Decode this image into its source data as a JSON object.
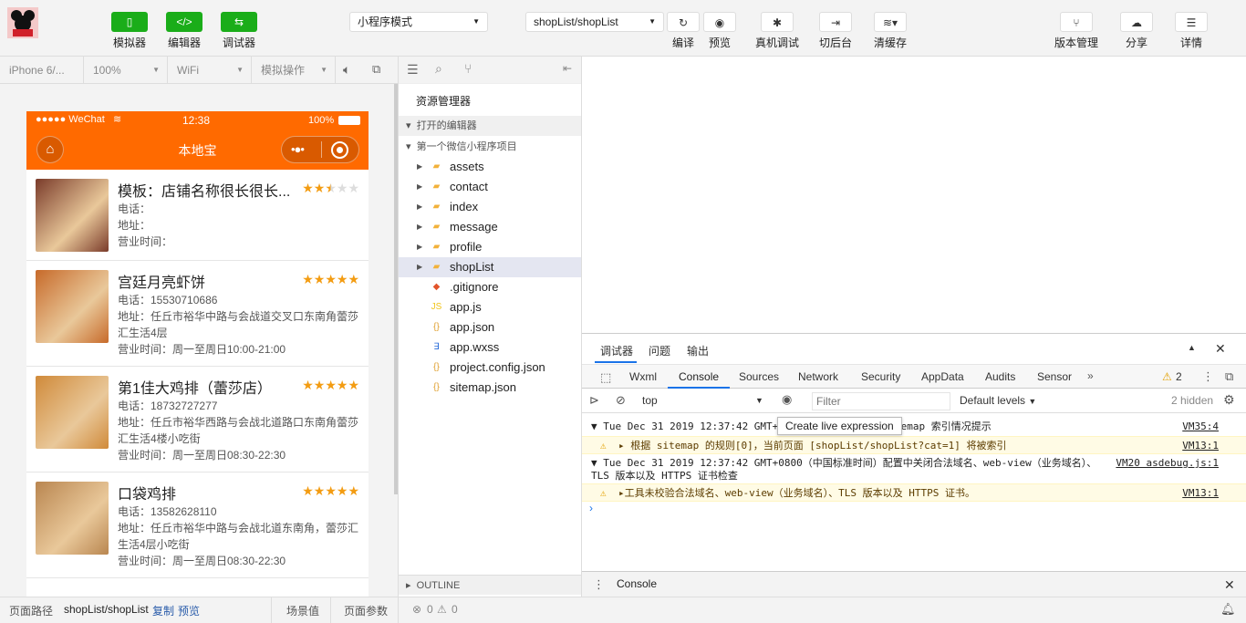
{
  "toolbar": {
    "left_buttons": [
      {
        "label": "模拟器",
        "icon": "phone-icon",
        "glyph": "▯"
      },
      {
        "label": "编辑器",
        "icon": "code-icon",
        "glyph": "</>"
      },
      {
        "label": "调试器",
        "icon": "debug-icon",
        "glyph": "⇆"
      }
    ],
    "mode_select": "小程序模式",
    "page_select": "shopList/shopList",
    "action_buttons": [
      {
        "label": "编译",
        "icon": "refresh-icon",
        "glyph": "↻"
      },
      {
        "label": "预览",
        "icon": "eye-icon",
        "glyph": "◉"
      },
      {
        "label": "真机调试",
        "icon": "bug-icon",
        "glyph": "✱"
      },
      {
        "label": "切后台",
        "icon": "switch-icon",
        "glyph": "⇥"
      },
      {
        "label": "清缓存",
        "icon": "layers-icon",
        "glyph": "≋▾"
      }
    ],
    "right_buttons": [
      {
        "label": "版本管理",
        "icon": "branch-icon",
        "glyph": "⑂"
      },
      {
        "label": "分享",
        "icon": "cloud-icon",
        "glyph": "☁"
      },
      {
        "label": "详情",
        "icon": "menu-icon",
        "glyph": "☰"
      }
    ]
  },
  "simbar": {
    "device": "iPhone 6/...",
    "zoom": "100%",
    "network": "WiFi",
    "operation": "模拟操作"
  },
  "phone": {
    "carrier": "●●●●● WeChat",
    "time": "12:38",
    "battery": "100%",
    "title": "本地宝",
    "shops": [
      {
        "name": "模板：店铺名称很长很长...",
        "rating": 2.5,
        "phone": "电话：",
        "address": "地址：",
        "hours": "营业时间：",
        "img_color": "#7a3b2a"
      },
      {
        "name": "宫廷月亮虾饼",
        "rating": 5,
        "phone": "电话：15530710686",
        "address": "地址：任丘市裕华中路与会战道交叉口东南角蕾莎汇生活4层",
        "hours": "营业时间：周一至周日10:00-21:00",
        "img_color": "#c76a2a"
      },
      {
        "name": "第1佳大鸡排（蕾莎店）",
        "rating": 5,
        "phone": "电话：18732727277",
        "address": "地址：任丘市裕华西路与会战北道路口东南角蕾莎汇生活4楼小吃街",
        "hours": "营业时间：周一至周日08:30-22:30",
        "img_color": "#d08a3a"
      },
      {
        "name": "口袋鸡排",
        "rating": 5,
        "phone": "电话：13582628110",
        "address": "地址：任丘市裕华中路与会战北道东南角，蕾莎汇生活4层小吃街",
        "hours": "营业时间：周一至周日08:30-22:30",
        "img_color": "#b98650"
      }
    ]
  },
  "explorer": {
    "title": "资源管理器",
    "open_editors": "打开的编辑器",
    "project": "第一个微信小程序项目",
    "outline": "OUTLINE",
    "nodes": [
      {
        "label": "assets",
        "type": "folder-special",
        "selected": false
      },
      {
        "label": "contact",
        "type": "folder",
        "selected": false
      },
      {
        "label": "index",
        "type": "folder",
        "selected": false
      },
      {
        "label": "message",
        "type": "folder",
        "selected": false
      },
      {
        "label": "profile",
        "type": "folder",
        "selected": false
      },
      {
        "label": "shopList",
        "type": "folder",
        "selected": true
      },
      {
        "label": ".gitignore",
        "type": "git",
        "selected": false
      },
      {
        "label": "app.js",
        "type": "js",
        "selected": false
      },
      {
        "label": "app.json",
        "type": "json",
        "selected": false
      },
      {
        "label": "app.wxss",
        "type": "css",
        "selected": false
      },
      {
        "label": "project.config.json",
        "type": "json",
        "selected": false
      },
      {
        "label": "sitemap.json",
        "type": "json",
        "selected": false
      }
    ]
  },
  "devtools": {
    "top_tabs": [
      "调试器",
      "问题",
      "输出"
    ],
    "panel_tabs": [
      "Wxml",
      "Console",
      "Sources",
      "Network",
      "Security",
      "AppData",
      "Audits",
      "Sensor"
    ],
    "warn_count": "2",
    "context": "top",
    "filter_placeholder": "Filter",
    "levels": "Default levels",
    "hidden": "2 hidden",
    "tooltip": "Create live expression",
    "messages": [
      {
        "text": "▼ Tue Dec 31 2019 12:37:42 GMT+0800（中国标准时间）sitemap 索引情况提示",
        "source": "VM35:4",
        "warn": false
      },
      {
        "text": "▸ 根据 sitemap 的规则[0]，当前页面 [shopList/shopList?cat=1] 将被索引",
        "source": "VM13:1",
        "warn": true
      },
      {
        "text": "▼ Tue Dec 31 2019 12:37:42 GMT+0800（中国标准时间）配置中关闭合法域名、web-view（业务域名）、TLS 版本以及 HTTPS 证书检查",
        "source": "VM20 asdebug.js:1",
        "warn": false
      },
      {
        "text": "▸工具未校验合法域名、web-view（业务域名）、TLS 版本以及 HTTPS 证书。",
        "source": "VM13:1",
        "warn": true
      }
    ],
    "drawer_tab": "Console"
  },
  "bottom": {
    "path_label": "页面路径",
    "path": "shopList/shopList",
    "copy": "复制",
    "preview": "预览",
    "scene": "场景值",
    "params": "页面参数",
    "errors": "0",
    "warnings": "0"
  }
}
